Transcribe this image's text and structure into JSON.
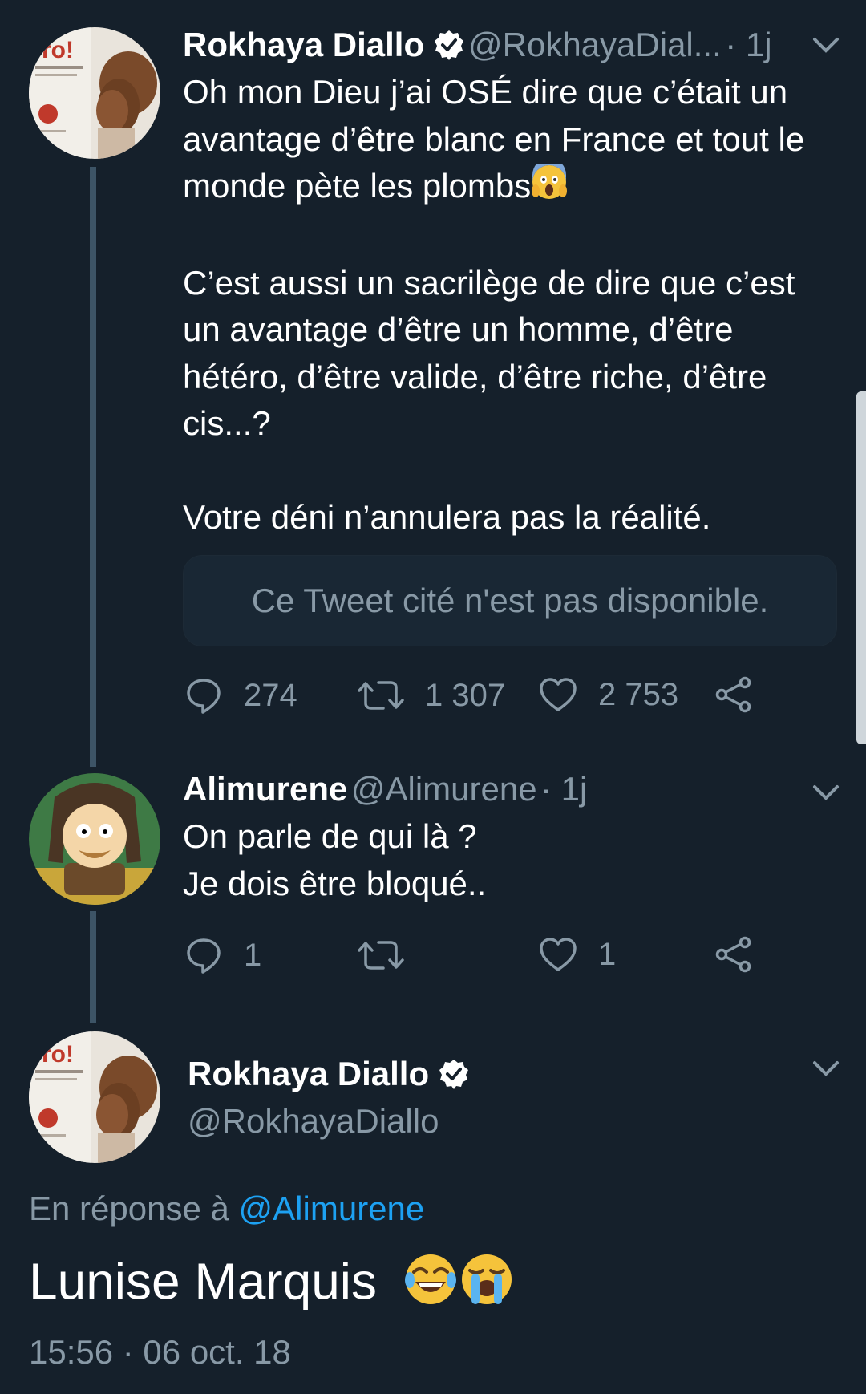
{
  "tweet1": {
    "name": "Rokhaya Diallo",
    "handle": "@RokhayaDial...",
    "time": "· 1j",
    "avatar_text": "fro!",
    "paragraphs": [
      "Oh mon Dieu j’ai OSÉ dire que c’était un avantage d’être blanc en France et tout le monde pète les plombs",
      "C’est aussi un sacrilège de dire que c’est un avantage d’être un homme, d’être hétéro, d’être valide, d’être riche, d’être cis...?",
      "Votre déni n’annulera pas la réalité."
    ],
    "quoted_unavailable": "Ce Tweet cité n'est pas disponible.",
    "replies": "274",
    "retweets": "1 307",
    "likes": "2 753"
  },
  "tweet2": {
    "name": "Alimurene",
    "handle": "@Alimurene",
    "time": "· 1j",
    "lines": [
      "On parle de qui là ?",
      "Je dois être bloqué.."
    ],
    "replies": "1",
    "retweets": "",
    "likes": "1"
  },
  "tweet3": {
    "name": "Rokhaya Diallo",
    "handle": "@RokhayaDiallo",
    "avatar_text": "fro!",
    "reply_prefix": "En réponse à",
    "reply_mention": "@Alimurene",
    "text": "Lunise Marquis",
    "timestamp": "15:56 · 06 oct. 18"
  },
  "icons": {
    "verified": "verified-badge-icon",
    "chevron": "chevron-down-icon",
    "reply": "reply-bubble-icon",
    "retweet": "retweet-icon",
    "like": "heart-icon",
    "share": "share-icon",
    "emoji_scream": "face-screaming-emoji",
    "emoji_joy": "face-with-tears-of-joy-emoji",
    "emoji_cry": "loudly-crying-face-emoji"
  },
  "colors": {
    "background": "#15202b",
    "secondary_text": "#8899a6",
    "link": "#1da1f2",
    "thread_line": "#3d5466"
  }
}
